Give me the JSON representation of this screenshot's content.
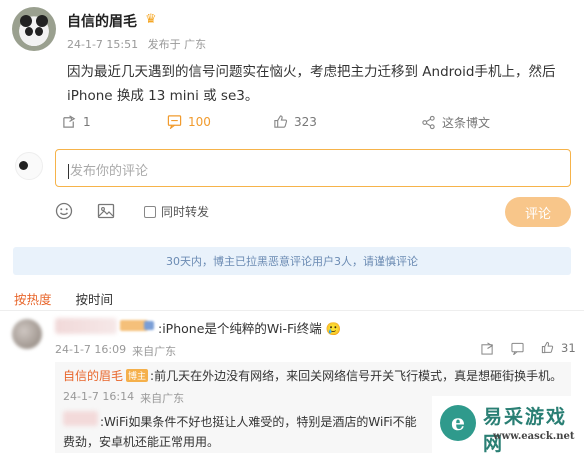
{
  "post": {
    "username": "自信的眉毛",
    "date": "24-1-7 15:51",
    "location": "发布于 广东",
    "content": "因为最近几天遇到的信号问题实在恼火，考虑把主力迁移到 Android手机上，然后 iPhone 换成 13 mini 或 se3。",
    "actions": {
      "repost_count": "1",
      "comment_count": "100",
      "like_count": "323",
      "more_label": "这条博文"
    }
  },
  "compose": {
    "placeholder": "发布你的评论",
    "repost_label": "同时转发",
    "submit_label": "评论"
  },
  "notice": "30天内，博主已拉黑恶意评论用户3人，请谨慎评论",
  "sort": {
    "hot": "按热度",
    "time": "按时间"
  },
  "comments": [
    {
      "text": ":iPhone是个纯粹的Wi-Fi终端",
      "date": "24-1-7 16:09",
      "location": "来自广东",
      "like_count": "31",
      "replies": [
        {
          "name": "自信的眉毛",
          "badge": "博主",
          "text": ":前几天在外边没有网络，来回关网络信号开关飞行模式，真是想砸街换手机。",
          "date": "24-1-7 16:14",
          "location": "来自广东"
        },
        {
          "text": ":WiFi如果条件不好也挺让人难受的，特别是酒店的WiFi不能",
          "text_cont": "费劲，安卓机还能正常用用。"
        }
      ]
    }
  ],
  "watermark": {
    "title": "易采游戏网",
    "url": "www.easck.net"
  },
  "colors": {
    "accent": "#f19b2e",
    "sort_active": "#e8662b",
    "notice_bg": "#e9f2fb"
  }
}
